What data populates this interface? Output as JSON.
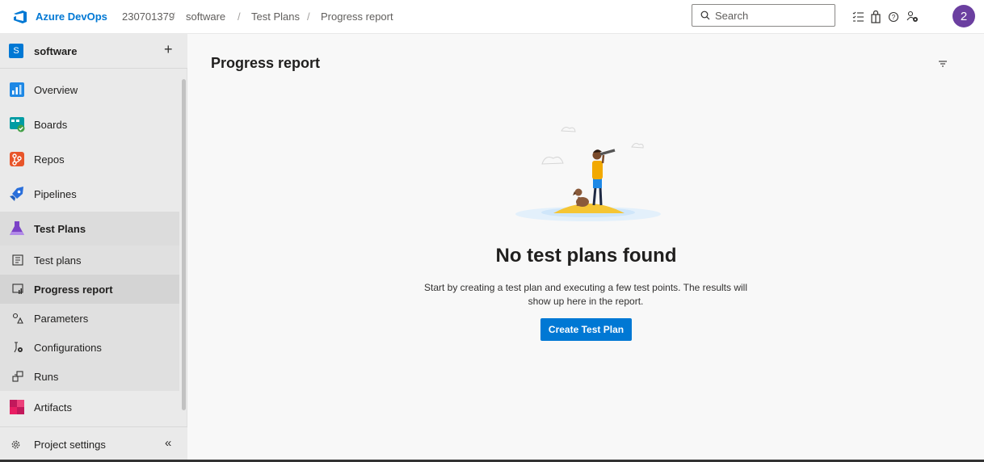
{
  "topbar": {
    "brand": "Azure DevOps",
    "org": "230701379",
    "breadcrumbs": [
      "software",
      "Test Plans",
      "Progress report"
    ],
    "search_placeholder": "Search",
    "avatar_initial": "2",
    "icons": [
      "task-list-icon",
      "shopping-bag-icon",
      "help-icon",
      "user-settings-icon"
    ]
  },
  "sidebar": {
    "project_initial": "S",
    "project_name": "software",
    "add_label": "+",
    "items": [
      {
        "label": "Overview",
        "icon": "overview-icon"
      },
      {
        "label": "Boards",
        "icon": "boards-icon"
      },
      {
        "label": "Repos",
        "icon": "repos-icon"
      },
      {
        "label": "Pipelines",
        "icon": "pipelines-icon"
      },
      {
        "label": "Test Plans",
        "icon": "test-plans-icon"
      },
      {
        "label": "Artifacts",
        "icon": "artifacts-icon"
      }
    ],
    "subitems": [
      {
        "label": "Test plans",
        "icon": "test-plans-list-icon"
      },
      {
        "label": "Progress report",
        "icon": "progress-report-icon"
      },
      {
        "label": "Parameters",
        "icon": "parameters-icon"
      },
      {
        "label": "Configurations",
        "icon": "configurations-icon"
      },
      {
        "label": "Runs",
        "icon": "runs-icon"
      }
    ],
    "settings_label": "Project settings",
    "collapse_label": "«"
  },
  "main": {
    "title": "Progress report",
    "empty_title": "No test plans found",
    "empty_desc_line1": "Start by creating a test plan and executing a few test points. The results will",
    "empty_desc_line2": "show up here in the report.",
    "create_button": "Create Test Plan"
  },
  "colors": {
    "accent": "#0078d4",
    "avatar": "#6b3fa0",
    "sidebar_bg": "#eaeaea",
    "content_bg": "#f8f8f8"
  }
}
